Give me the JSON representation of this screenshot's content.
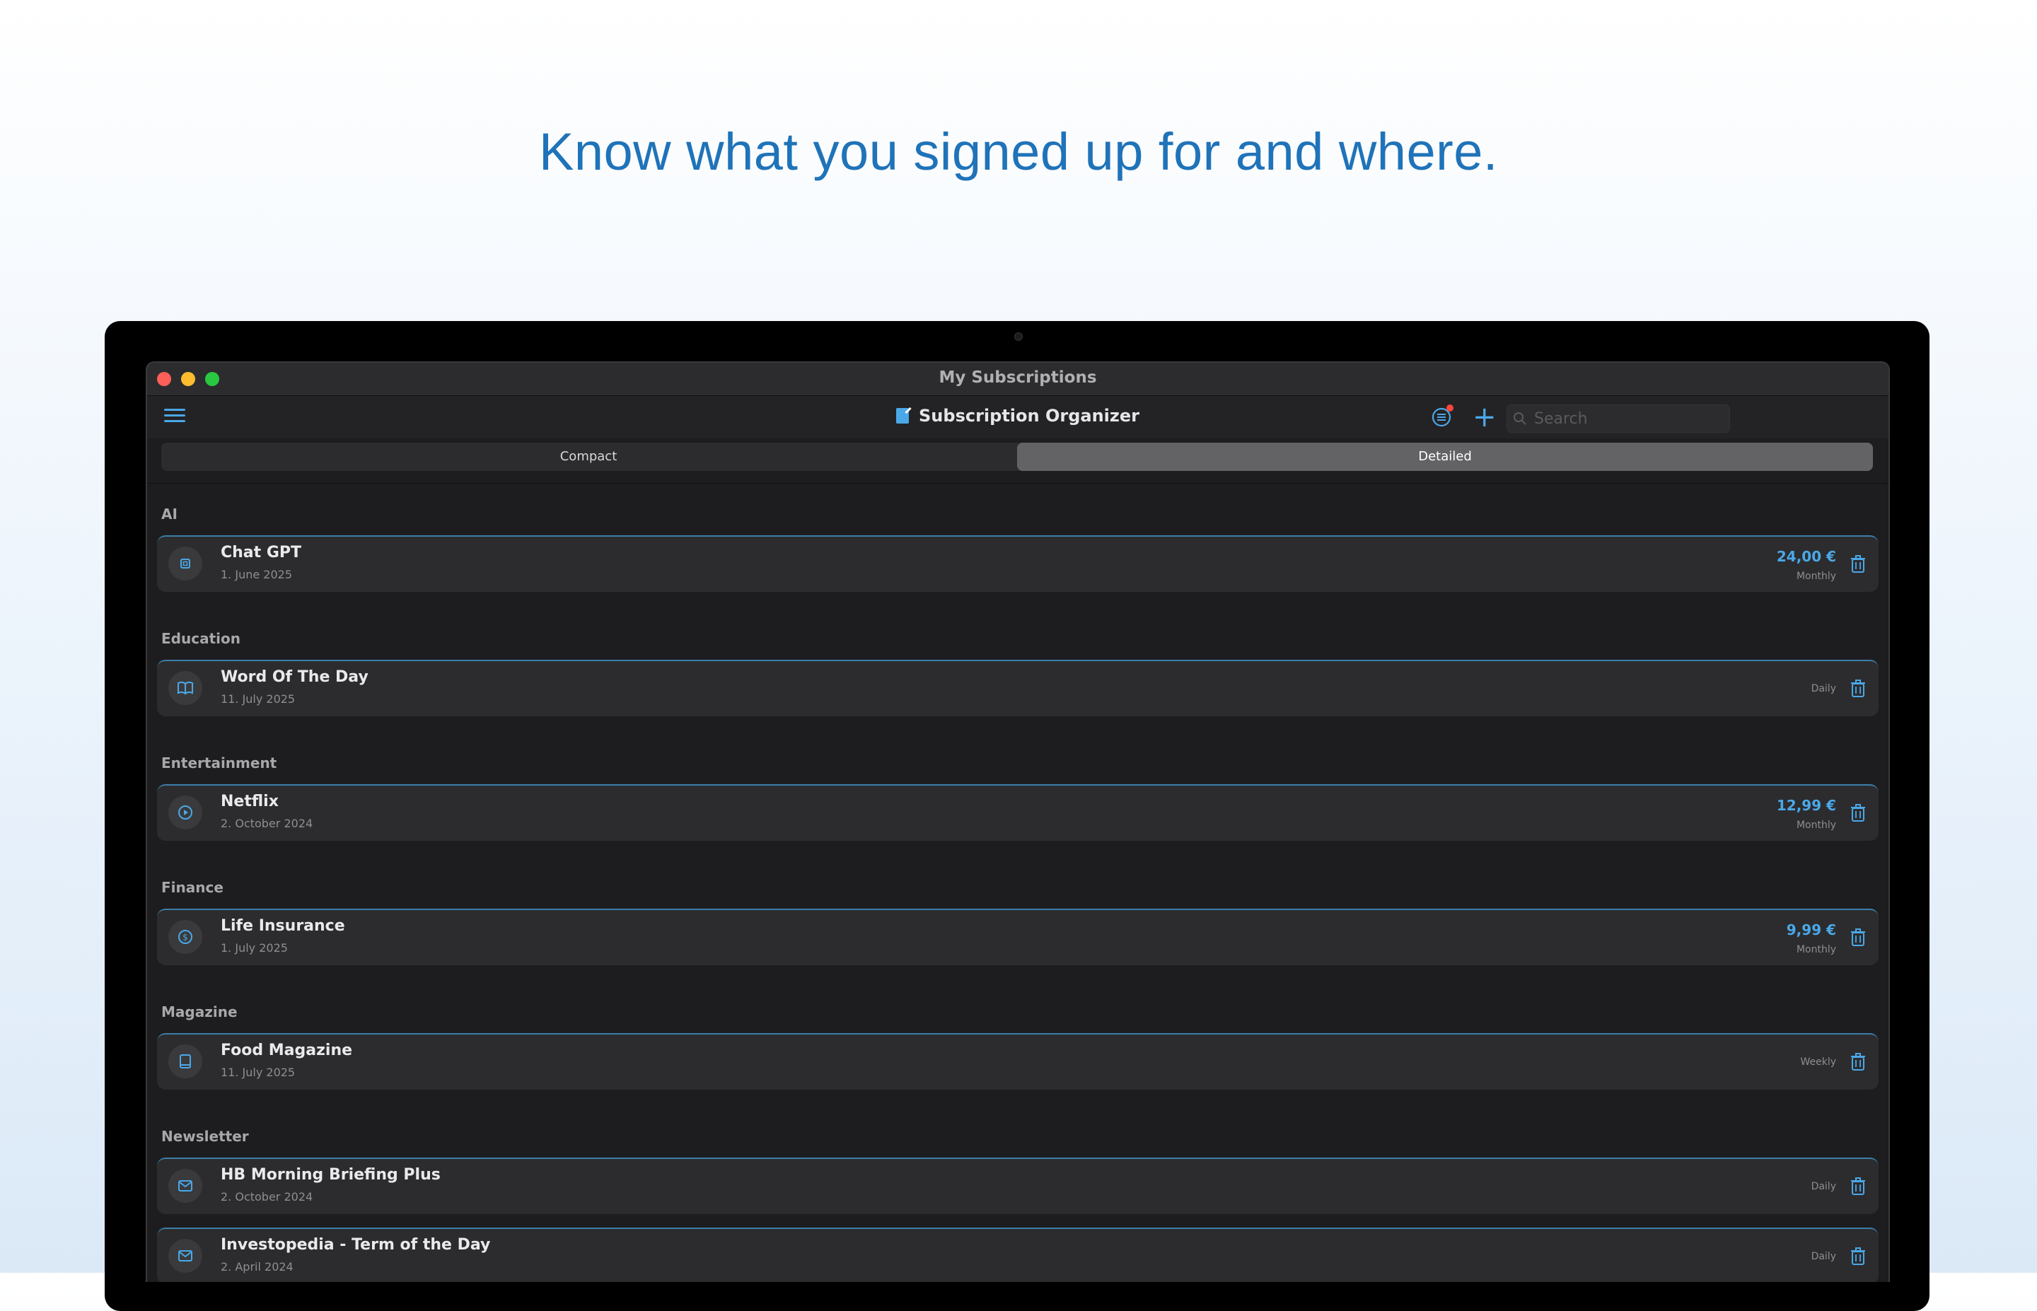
{
  "headline": "Know what you signed up for and where.",
  "window": {
    "title": "My Subscriptions"
  },
  "toolbar": {
    "app_title": "Subscription Organizer",
    "search_placeholder": "Search"
  },
  "view_modes": {
    "compact": "Compact",
    "detailed": "Detailed",
    "selected": "Detailed"
  },
  "colors": {
    "accent": "#4aa8e8",
    "headline": "#1f73b9",
    "row_bg": "#2c2c2e"
  },
  "groups": [
    {
      "title": "AI",
      "items": [
        {
          "icon": "cpu-icon",
          "name": "Chat GPT",
          "date": "1. June 2025",
          "price": "24,00 €",
          "frequency": "Monthly"
        }
      ]
    },
    {
      "title": "Education",
      "items": [
        {
          "icon": "book-icon",
          "name": "Word Of The Day",
          "date": "11. July 2025",
          "price": "",
          "frequency": "Daily"
        }
      ]
    },
    {
      "title": "Entertainment",
      "items": [
        {
          "icon": "play-icon",
          "name": "Netflix",
          "date": "2. October 2024",
          "price": "12,99 €",
          "frequency": "Monthly"
        }
      ]
    },
    {
      "title": "Finance",
      "items": [
        {
          "icon": "dollar-icon",
          "name": "Life Insurance",
          "date": "1. July 2025",
          "price": "9,99 €",
          "frequency": "Monthly"
        }
      ]
    },
    {
      "title": "Magazine",
      "items": [
        {
          "icon": "magazine-icon",
          "name": "Food Magazine",
          "date": "11. July 2025",
          "price": "",
          "frequency": "Weekly"
        }
      ]
    },
    {
      "title": "Newsletter",
      "items": [
        {
          "icon": "envelope-icon",
          "name": "HB Morning Briefing Plus",
          "date": "2. October 2024",
          "price": "",
          "frequency": "Daily"
        },
        {
          "icon": "envelope-icon",
          "name": "Investopedia - Term of the Day",
          "date": "2. April 2024",
          "price": "",
          "frequency": "Daily"
        }
      ]
    }
  ]
}
